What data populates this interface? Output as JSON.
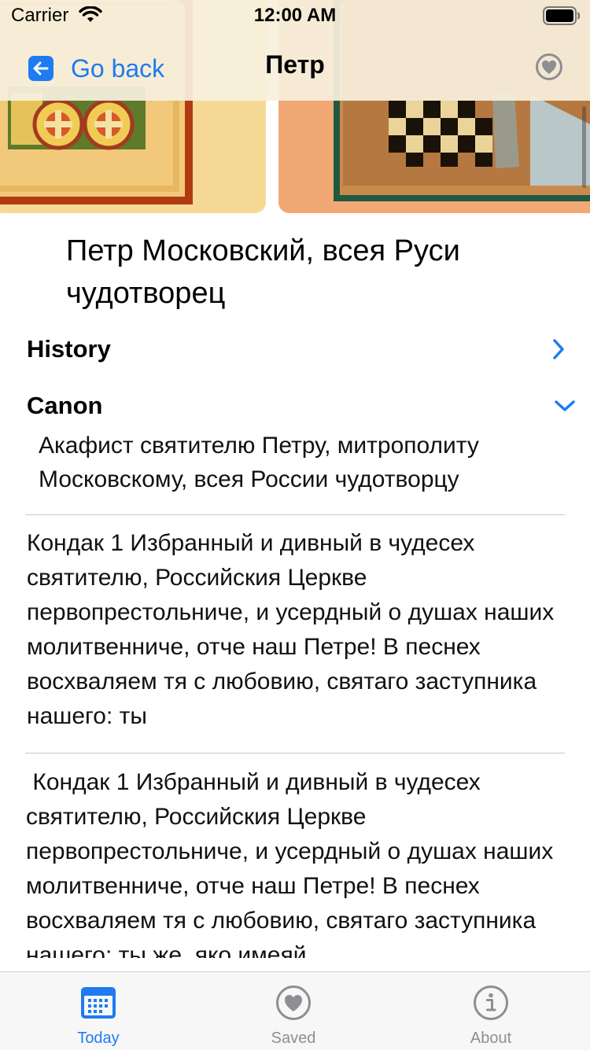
{
  "status_bar": {
    "carrier": "Carrier",
    "time": "12:00 AM"
  },
  "nav": {
    "back_label": "Go back",
    "title": "Петр",
    "favorite_icon": "heart-circle-icon"
  },
  "saint": {
    "name": "Петр Московский, всея Руси чудотворец"
  },
  "sections": [
    {
      "label": "History",
      "expanded": false
    },
    {
      "label": "Canon",
      "expanded": true
    }
  ],
  "canon": {
    "title": "Акафист святителю Петру, митрополиту Московскому, всея России чудотворцу",
    "paragraphs": [
      "Кондак 1 Избранный и дивный в чудесех святителю, Российския Церкве первопрестольниче, и усердный о душах наших молитвенниче, отче наш Петре! В песнех восхваляем тя с любовию, святаго заступника нашего: ты",
      " Кондак 1 Избранный и дивный в чудесех святителю, Российския Церкве первопрестольниче, и усердный о душах наших молитвенниче, отче наш Петре! В песнех восхваляем тя с любовию, святаго заступника нашего: ты же, яко имеяй"
    ]
  },
  "tabs": [
    {
      "label": "Today",
      "icon": "calendar-icon",
      "active": true
    },
    {
      "label": "Saved",
      "icon": "heart-circle-icon",
      "active": false
    },
    {
      "label": "About",
      "icon": "info-circle-icon",
      "active": false
    }
  ],
  "colors": {
    "accent": "#1E7BF1",
    "inactive": "#8E8E93",
    "nav_bg": "#F8F0DE"
  }
}
